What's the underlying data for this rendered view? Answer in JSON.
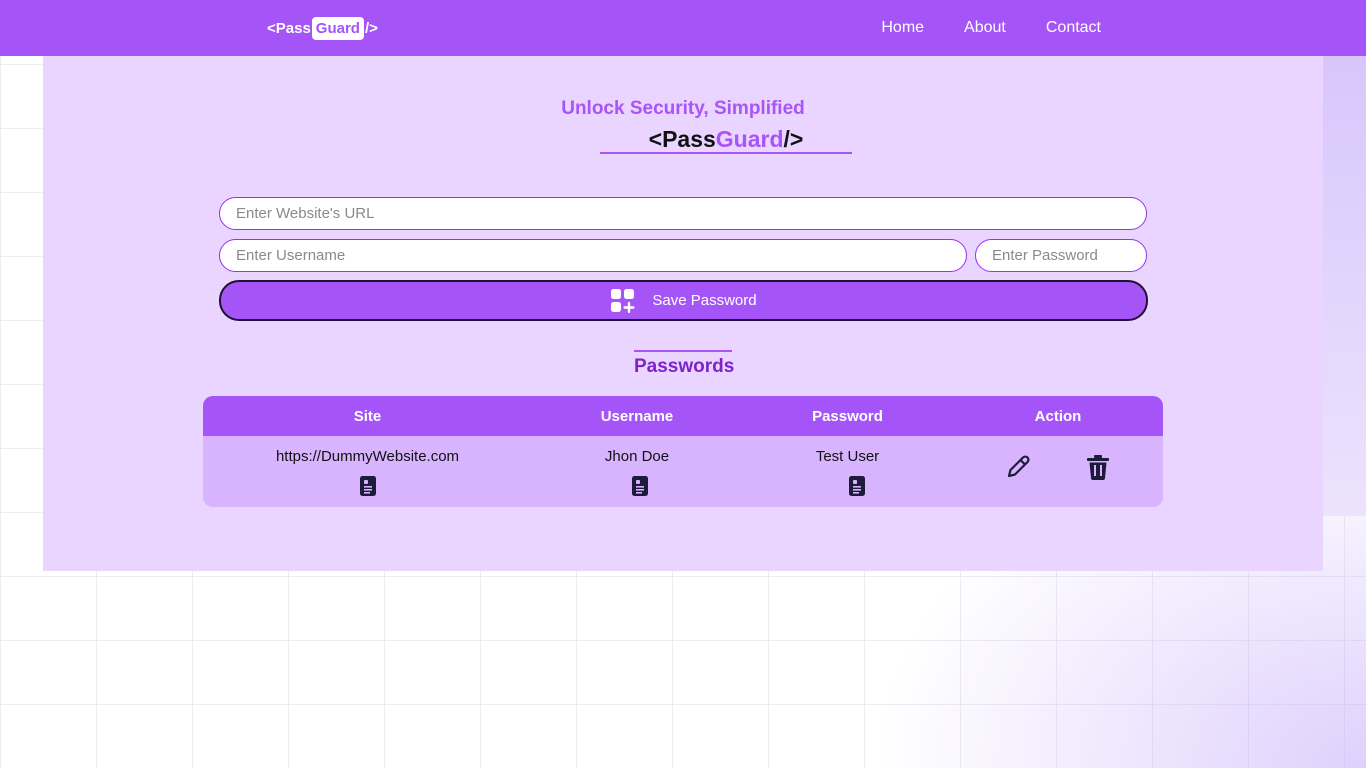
{
  "nav": {
    "logo": {
      "open": "<Pass",
      "accent": "Guard",
      "close": "/>"
    },
    "links": [
      "Home",
      "About",
      "Contact"
    ]
  },
  "hero": {
    "title": {
      "open": "<Pass",
      "accent": "Guard",
      "close": "/>"
    },
    "tagline": "Unlock Security, Simplified"
  },
  "form": {
    "url_placeholder": "Enter Website's URL",
    "username_placeholder": "Enter Username",
    "password_placeholder": "Enter Password",
    "url_value": "",
    "username_value": "",
    "password_value": "",
    "save_label": "Save Password",
    "save_icon": "add-square-icon"
  },
  "passwords": {
    "title": "Passwords",
    "columns": [
      "Site",
      "Username",
      "Password",
      "Action"
    ],
    "rows": [
      {
        "site": "https://DummyWebsite.com",
        "username": "Jhon Doe",
        "password": "Test User"
      }
    ],
    "icons": {
      "copy": "copy-icon",
      "edit": "pencil-icon",
      "delete": "trash-icon"
    }
  },
  "colors": {
    "primary": "#a555f7",
    "card_bg": "#e9d5ff",
    "table_row_bg": "#d8b4fe",
    "accent_text": "#a855f7",
    "section_title": "#7e22ce"
  }
}
